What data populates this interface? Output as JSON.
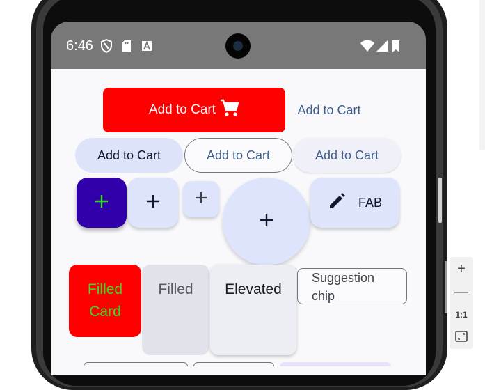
{
  "status_bar": {
    "time": "6:46",
    "icons": [
      "shield-icon",
      "sd-card-icon",
      "a-letter-icon",
      "wifi-icon",
      "signal-icon",
      "battery-icon"
    ]
  },
  "buttons": {
    "filled_red": {
      "label": "Add to Cart",
      "icon": "cart-icon",
      "color": "#ff0000"
    },
    "text": {
      "label": "Add to Cart"
    },
    "tonal": {
      "label": "Add to Cart"
    },
    "outlined": {
      "label": "Add to Cart"
    },
    "elevated": {
      "label": "Add to Cart"
    }
  },
  "fabs": {
    "primary": {
      "icon": "plus-icon",
      "color": "#3200aa",
      "icon_color": "#33dd22"
    },
    "normal": {
      "icon": "plus-icon"
    },
    "small": {
      "icon": "plus-icon"
    },
    "large": {
      "icon": "plus-icon"
    },
    "extended": {
      "icon": "pencil-icon",
      "label": "FAB"
    }
  },
  "cards": {
    "custom": {
      "label": "Filled Card",
      "color": "#ff0000",
      "text_color": "#33dd22"
    },
    "filled": {
      "label": "Filled"
    },
    "elevated": {
      "label": "Elevated"
    }
  },
  "chip": {
    "label": "Suggestion chip"
  },
  "emulator_controls": {
    "zoom_in": "+",
    "zoom_out": "—",
    "actual_size": "1:1",
    "fit": "fit-screen-icon"
  }
}
